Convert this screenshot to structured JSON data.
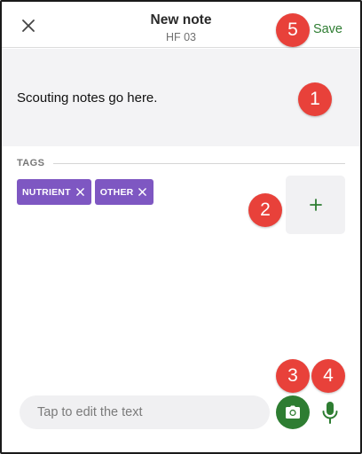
{
  "header": {
    "title": "New note",
    "subtitle": "HF 03",
    "save_label": "Save",
    "close_icon": "close-icon"
  },
  "notes": {
    "text": "Scouting notes go here."
  },
  "tags": {
    "section_label": "TAGS",
    "items": [
      {
        "label": "NUTRIENT"
      },
      {
        "label": "OTHER"
      }
    ],
    "add_icon": "plus-icon"
  },
  "composer": {
    "placeholder": "Tap to edit the text",
    "camera_icon": "camera-icon",
    "mic_icon": "microphone-icon"
  },
  "markers": [
    "1",
    "2",
    "3",
    "4",
    "5"
  ],
  "colors": {
    "accent_green": "#2e7d32",
    "tag_purple": "#7e57c2",
    "marker_red": "#e8413a",
    "notes_bg": "#f3f3f5"
  }
}
